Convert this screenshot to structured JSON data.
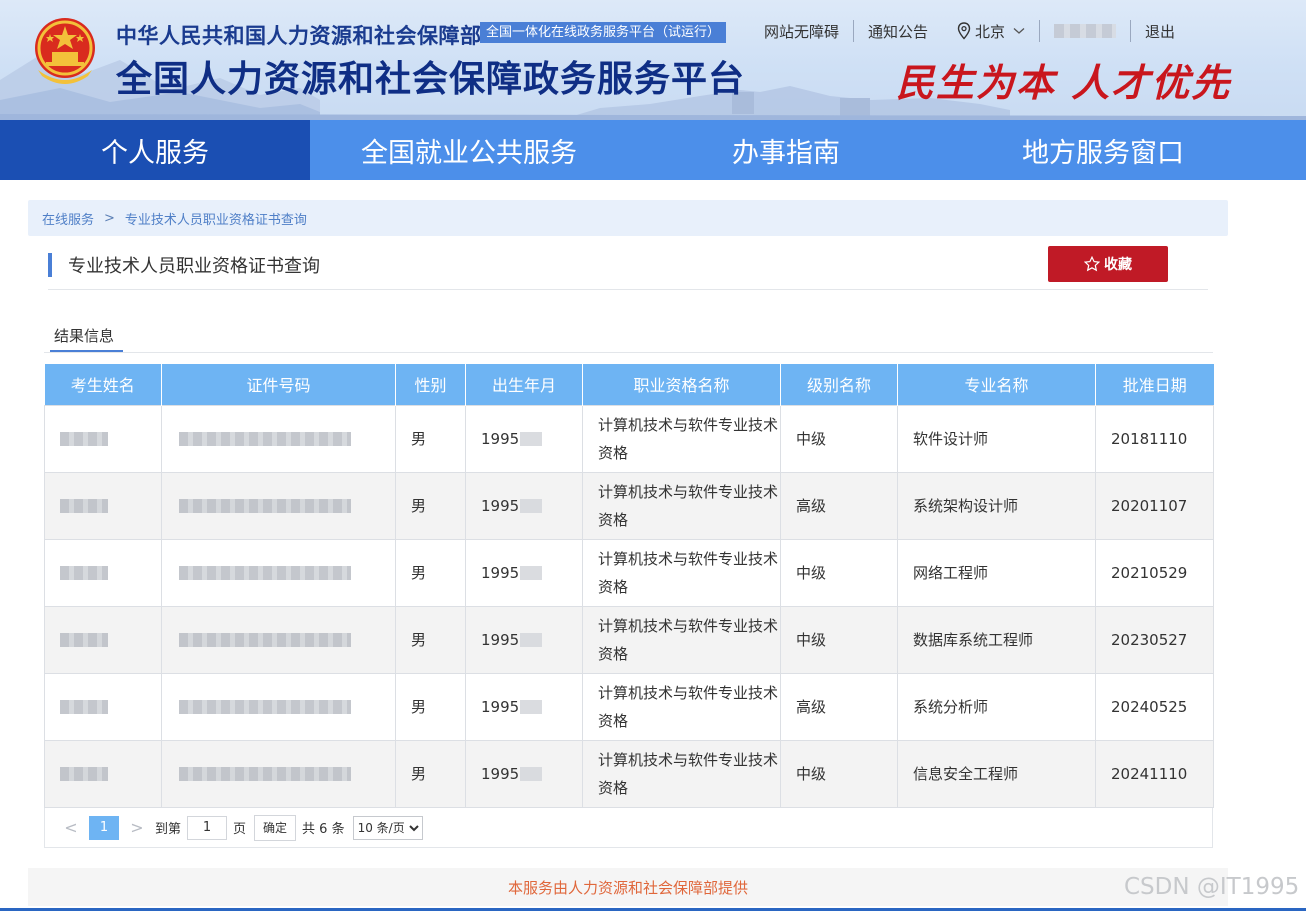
{
  "header": {
    "ministry": "中华人民共和国人力资源和社会保障部",
    "trial_badge": "全国一体化在线政务服务平台（试运行）",
    "platform_title": "全国人力资源和社会保障政务服务平台",
    "slogan": "民生为本 人才优先",
    "links": {
      "accessibility": "网站无障碍",
      "notice": "通知公告",
      "location": "北京",
      "logout": "退出"
    }
  },
  "nav": {
    "items": [
      {
        "label": "个人服务",
        "active": true
      },
      {
        "label": "全国就业公共服务",
        "active": false
      },
      {
        "label": "办事指南",
        "active": false
      },
      {
        "label": "地方服务窗口",
        "active": false
      }
    ]
  },
  "breadcrumb": {
    "home": "在线服务",
    "separator": ">",
    "current": "专业技术人员职业资格证书查询"
  },
  "page": {
    "title": "专业技术人员职业资格证书查询",
    "favorite_label": "收藏",
    "result_tab": "结果信息"
  },
  "table": {
    "headers": [
      "考生姓名",
      "证件号码",
      "性别",
      "出生年月",
      "职业资格名称",
      "级别名称",
      "专业名称",
      "批准日期"
    ],
    "rows": [
      {
        "gender": "男",
        "birth": "1995",
        "qualification": "计算机技术与软件专业技术资格",
        "level": "中级",
        "major": "软件设计师",
        "date": "20181110"
      },
      {
        "gender": "男",
        "birth": "1995",
        "qualification": "计算机技术与软件专业技术资格",
        "level": "高级",
        "major": "系统架构设计师",
        "date": "20201107"
      },
      {
        "gender": "男",
        "birth": "1995",
        "qualification": "计算机技术与软件专业技术资格",
        "level": "中级",
        "major": "网络工程师",
        "date": "20210529"
      },
      {
        "gender": "男",
        "birth": "1995",
        "qualification": "计算机技术与软件专业技术资格",
        "level": "中级",
        "major": "数据库系统工程师",
        "date": "20230527"
      },
      {
        "gender": "男",
        "birth": "1995",
        "qualification": "计算机技术与软件专业技术资格",
        "level": "高级",
        "major": "系统分析师",
        "date": "20240525"
      },
      {
        "gender": "男",
        "birth": "1995",
        "qualification": "计算机技术与软件专业技术资格",
        "level": "中级",
        "major": "信息安全工程师",
        "date": "20241110"
      }
    ]
  },
  "pagination": {
    "prev": "<",
    "current_page": "1",
    "next": ">",
    "goto_label": "到第",
    "goto_value": "1",
    "page_label": "页",
    "confirm_label": "确定",
    "total": "共 6 条",
    "page_size": "10 条/页"
  },
  "footer": {
    "text": "本服务由人力资源和社会保障部提供"
  },
  "watermark": "CSDN @IT1995",
  "colors": {
    "nav_bg": "#4c8fea",
    "nav_active": "#1b4fb3",
    "table_header": "#6eb4f3",
    "favorite_button": "#c01a26",
    "footer_text": "#e0673b"
  }
}
